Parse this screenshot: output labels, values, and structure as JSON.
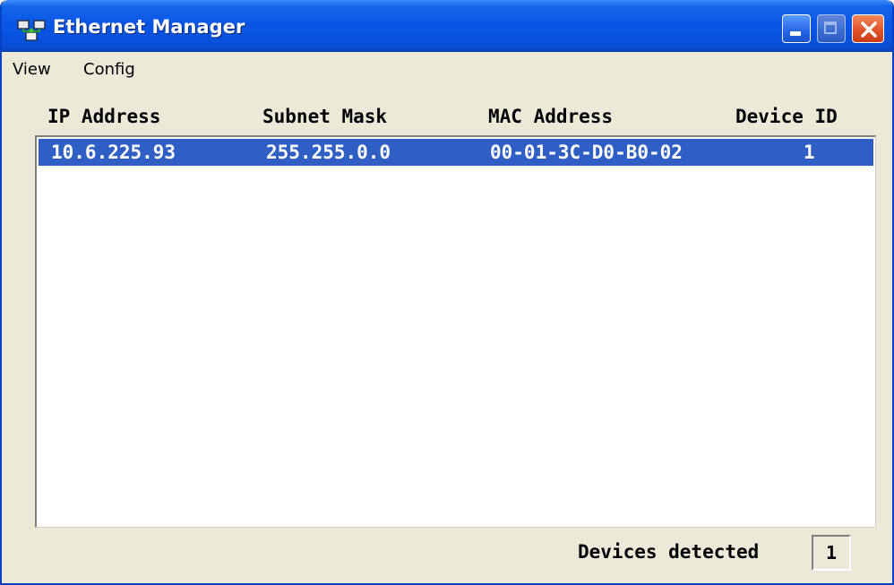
{
  "window": {
    "title": "Ethernet Manager",
    "icon": "network-icon"
  },
  "titlebar_buttons": {
    "minimize_icon": "minimize-icon",
    "maximize_icon": "maximize-icon",
    "close_icon": "close-icon"
  },
  "menu": {
    "items": [
      {
        "label": "View"
      },
      {
        "label": "Config"
      }
    ]
  },
  "table": {
    "columns": [
      "IP Address",
      "Subnet Mask",
      "MAC Address",
      "Device ID"
    ],
    "rows": [
      {
        "ip": "10.6.225.93",
        "subnet": "255.255.0.0",
        "mac": "00-01-3C-D0-B0-02",
        "device_id": "1",
        "selected": true
      }
    ]
  },
  "status": {
    "label": "Devices detected",
    "count": "1"
  },
  "colors": {
    "titlebar": "#0a56e4",
    "selection": "#2f5fc5",
    "window_bg": "#ece9d8",
    "close_button": "#e2542b"
  }
}
